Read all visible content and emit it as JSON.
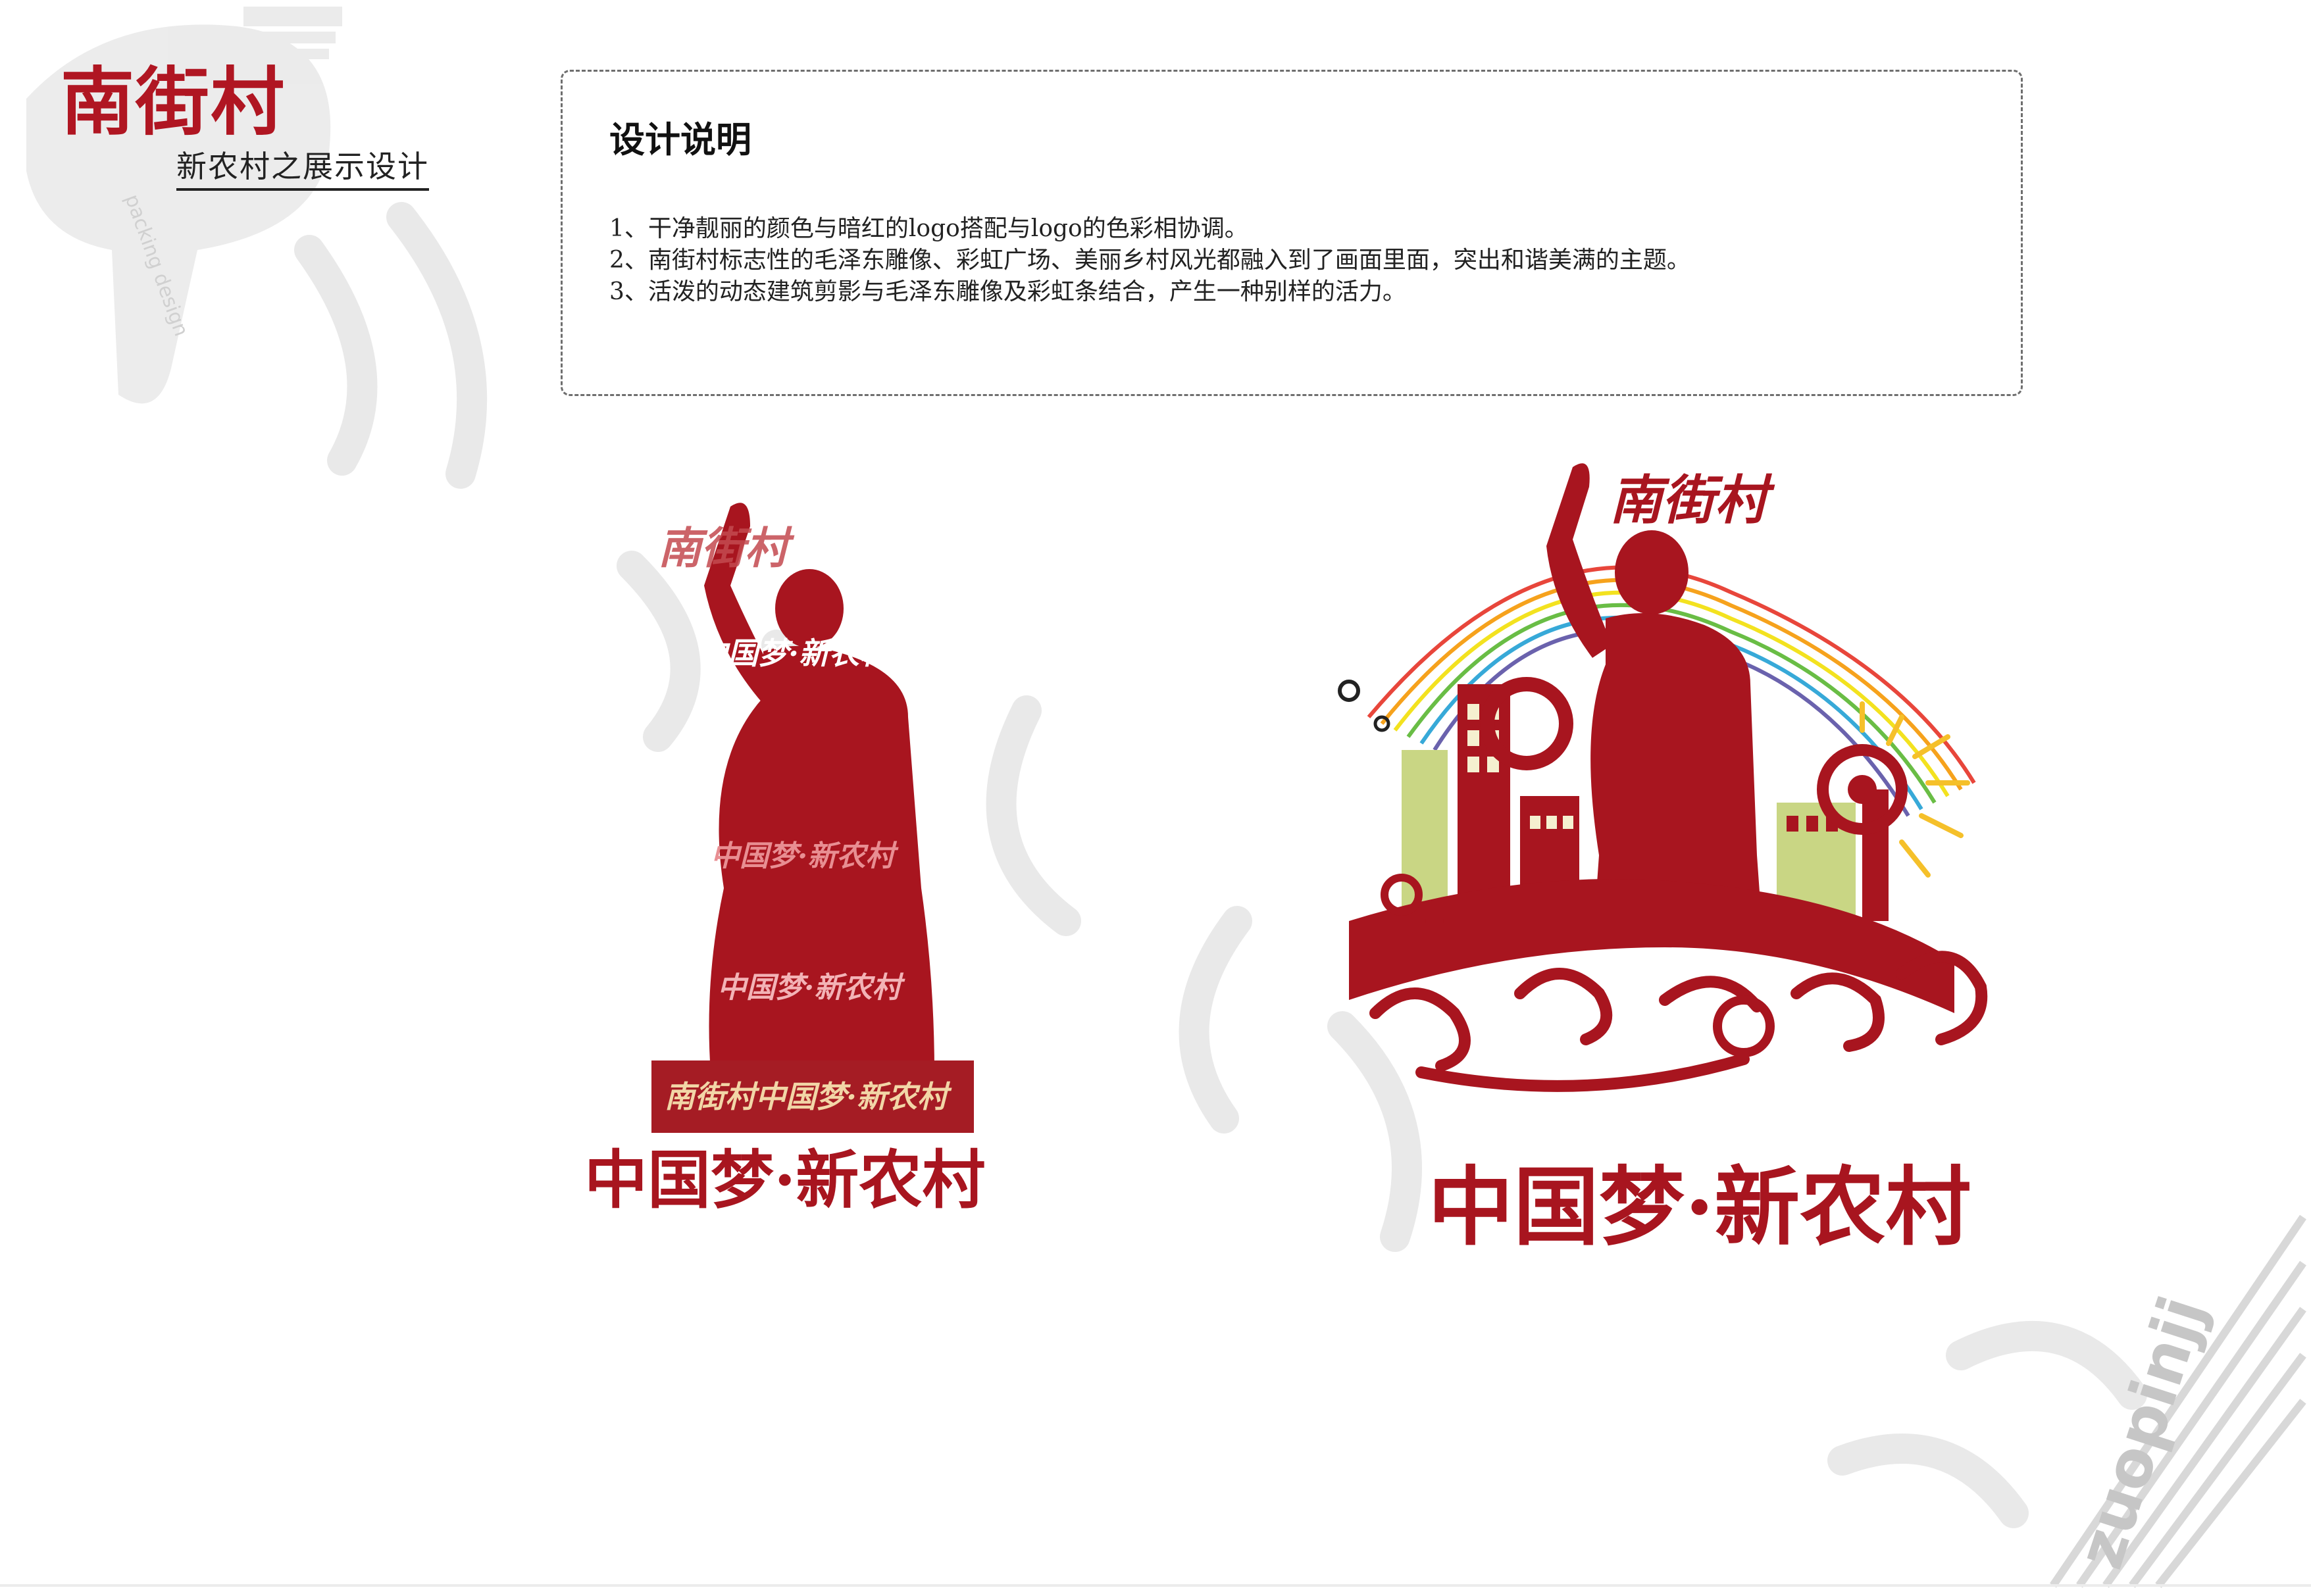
{
  "header": {
    "brand": "南街村",
    "subtitle": "新农村之展示设计"
  },
  "description": {
    "title": "设计说明",
    "items": [
      "1、干净靓丽的颜色与暗红的logo搭配与logo的色彩相协调。",
      "2、南街村标志性的毛泽东雕像、彩虹广场、美丽乡村风光都融入到了画面里面，突出和谐美满的主题。",
      "3、活泼的动态建筑剪影与毛泽东雕像及彩虹条结合，产生一种别样的活力。"
    ]
  },
  "logo_left": {
    "name": "南街村",
    "repeat_slogan": "中国梦·新农村",
    "plaque_text": "南街村中国梦·新农村",
    "slogan": "中国梦·新农村"
  },
  "logo_right": {
    "name": "南街村",
    "slogan": "中国梦·新农村"
  },
  "watermark": {
    "vertical_text": "packing design",
    "corner_text": "zuopinjj"
  },
  "colors": {
    "brand_red": "#a8151f",
    "rainbow": [
      "#e8463b",
      "#f6a21c",
      "#f3e21f",
      "#69bd45",
      "#37a9d8",
      "#6a62ad"
    ],
    "accent_green": "#c9d684",
    "accent_yellow": "#f5c02a"
  }
}
